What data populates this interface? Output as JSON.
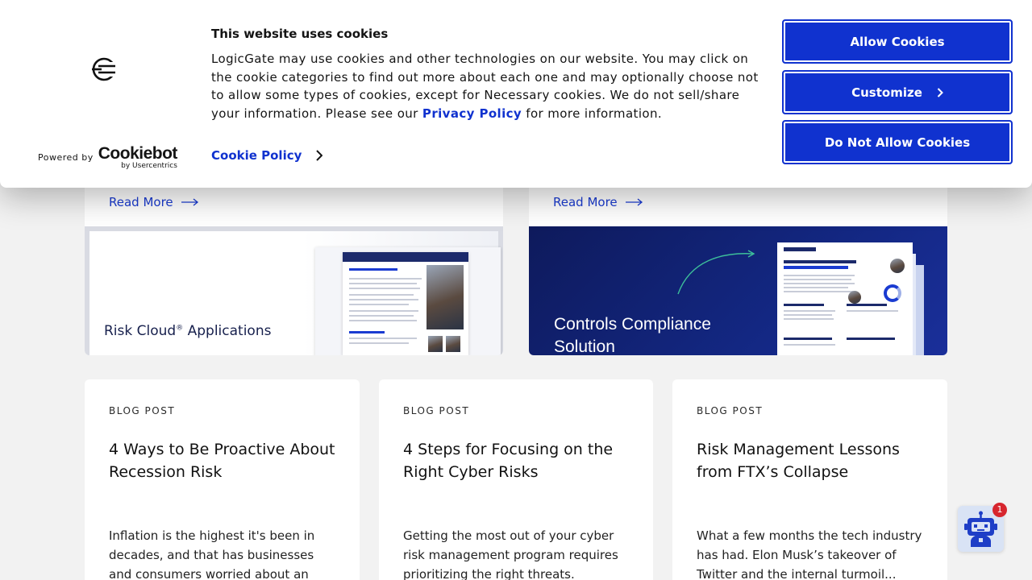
{
  "cookie_banner": {
    "title": "This website uses cookies",
    "body_text": "LogicGate may use cookies and other technologies on our website. You may click on the cookie categories to find out more about each one and may optionally choose not to allow some types of cookies, except for Necessary cookies.  We do not sell/share your information. Please see our ",
    "privacy_link": "Privacy Policy",
    "body_suffix": " for more information.",
    "cookie_policy_link": "Cookie Policy",
    "powered_by": "Powered by",
    "cookiebot_word": "Cookiebot",
    "cookiebot_sub": "by Usercentrics",
    "buttons": {
      "allow": "Allow Cookies",
      "customize": "Customize",
      "deny": "Do Not Allow Cookies"
    },
    "accent_color": "#1032cf"
  },
  "resources": {
    "read_more": "Read More",
    "featured": [
      {
        "thumb_title": "Risk Cloud",
        "thumb_title_mark": "®",
        "thumb_title_rest": " Applications"
      },
      {
        "thumb_title_line1": "Controls Compliance",
        "thumb_title_line2": "Solution"
      }
    ],
    "blog_cards": [
      {
        "eyebrow": "BLOG POST",
        "title": "4 Ways to Be Proactive About Recession Risk",
        "excerpt": "Inflation is the highest it's been in decades, and that has businesses and consumers worried about an"
      },
      {
        "eyebrow": "BLOG POST",
        "title": "4 Steps for Focusing on the Right Cyber Risks",
        "excerpt": "Getting the most out of your cyber risk management program requires prioritizing the right threats."
      },
      {
        "eyebrow": "BLOG POST",
        "title": "Risk Management Lessons from FTX’s Collapse",
        "excerpt": "What a few months the tech industry has had.  Elon Musk’s takeover of Twitter and the internal turmoil..."
      }
    ]
  },
  "chat_widget": {
    "icon": "robot-icon",
    "badge_count": "1"
  }
}
